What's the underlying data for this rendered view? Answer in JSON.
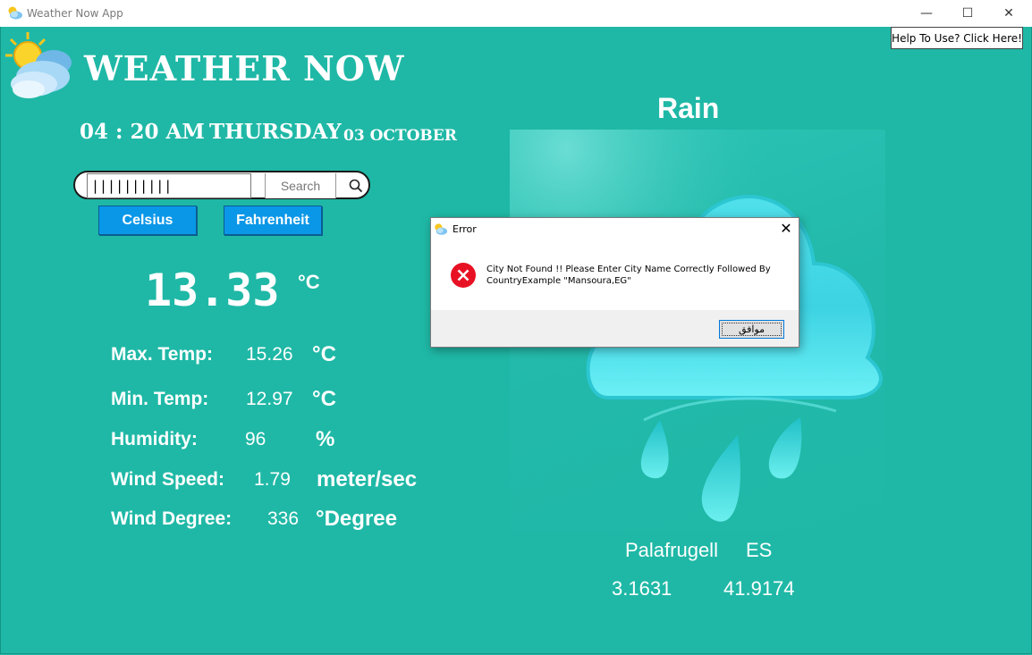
{
  "window": {
    "title": "Weather Now App",
    "minimize_glyph": "—",
    "maximize_glyph": "☐",
    "close_glyph": "✕"
  },
  "help_button": "Help To Use? Click Here!",
  "header": {
    "app_title": "WEATHER NOW",
    "time": "04 : 20 AM",
    "day": "THURSDAY",
    "date": "03 OCTOBER"
  },
  "search": {
    "value": "||||||||||",
    "button_label": "Search",
    "icon": "search-icon"
  },
  "units": {
    "celsius_label": "Celsius",
    "fahrenheit_label": "Fahrenheit"
  },
  "current": {
    "temp": "13.33",
    "unit": "°C"
  },
  "stats": [
    {
      "label": "Max. Temp:",
      "value": "15.26",
      "unit": "°C"
    },
    {
      "label": "Min. Temp:",
      "value": "12.97",
      "unit": "°C"
    },
    {
      "label": "Humidity:",
      "value": "96",
      "unit": "%"
    },
    {
      "label": "Wind Speed:",
      "value": "1.79",
      "unit": "meter/sec"
    },
    {
      "label": "Wind Degree:",
      "value": "336",
      "unit": "°Degree"
    }
  ],
  "weather": {
    "description": "Rain",
    "icon": "rain-cloud-icon"
  },
  "location": {
    "city": "Palafrugell",
    "country": "ES",
    "lon": "3.1631",
    "lat": "41.9174"
  },
  "dialog": {
    "title": "Error",
    "close_glyph": "✕",
    "message": "City Not Found !! Please Enter City Name Correctly Followed By CountryExample  \"Mansoura,EG\"",
    "ok_label": "موافق"
  },
  "colors": {
    "background": "#1fb8a6",
    "button_blue": "#0b97e8",
    "error_red": "#e81123"
  }
}
